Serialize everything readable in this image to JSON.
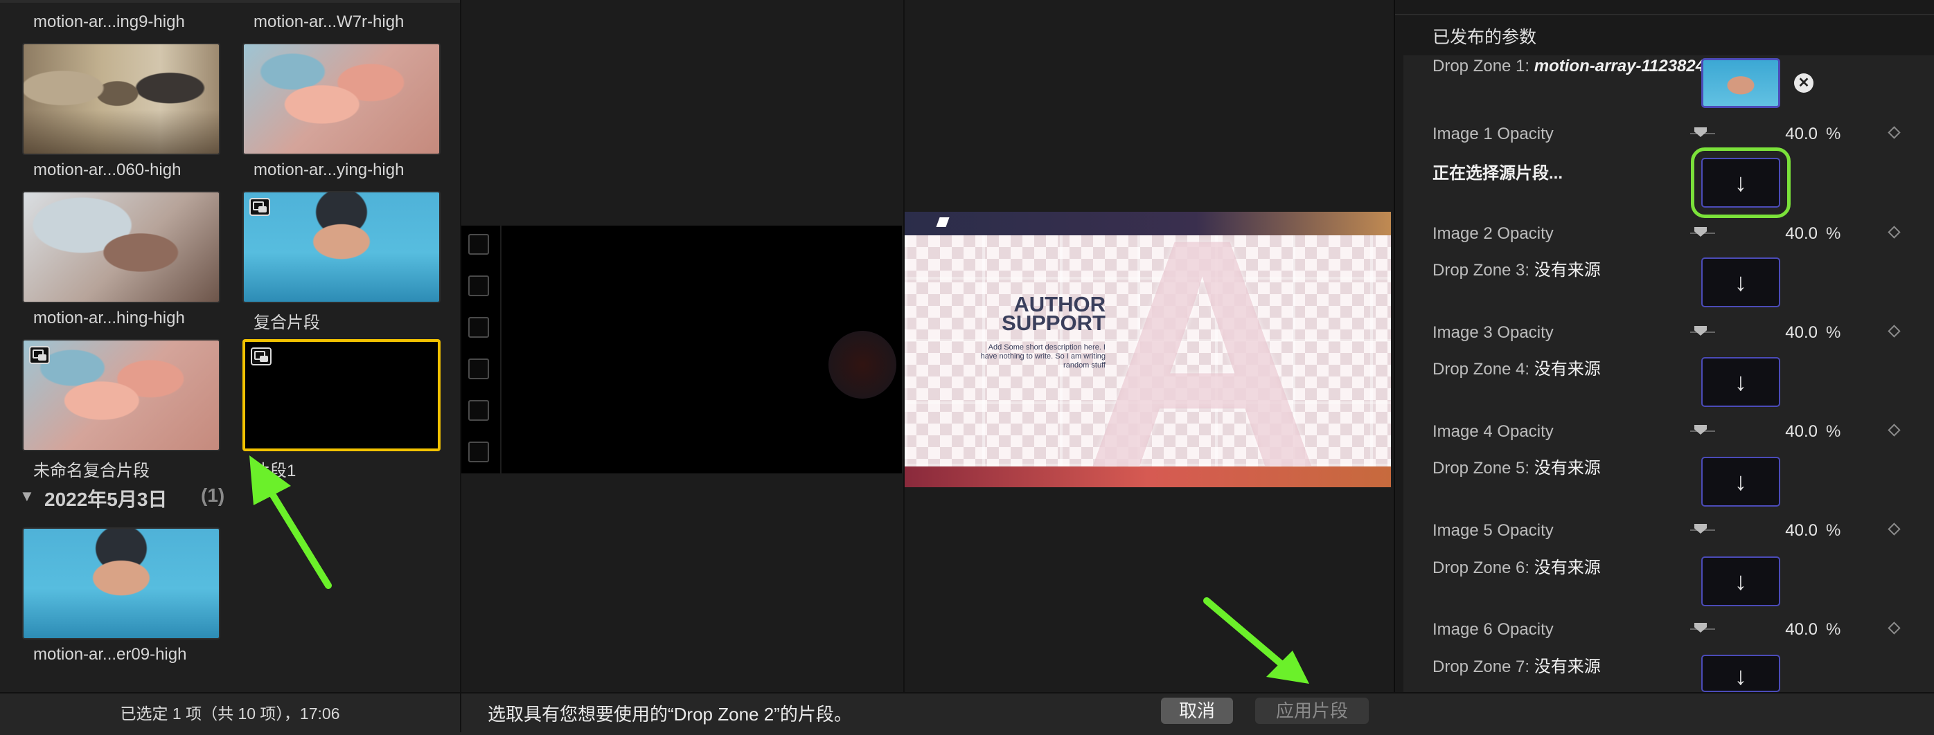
{
  "browser": {
    "clips": [
      {
        "label": "motion-ar...ing9-high"
      },
      {
        "label": "motion-ar...W7r-high"
      },
      {
        "label": "motion-ar...060-high"
      },
      {
        "label": "motion-ar...ying-high"
      },
      {
        "label": "motion-ar...hing-high"
      },
      {
        "label": "复合片段"
      },
      {
        "label": "未命名复合片段"
      },
      {
        "label": "片段1"
      },
      {
        "label": "motion-ar...er09-high"
      }
    ],
    "group": {
      "arrow": "▼",
      "date": "2022年5月3日",
      "count": "(1)"
    },
    "status": "已选定 1 项（共 10 项），17:06"
  },
  "template": {
    "title_line1": "AUTHOR",
    "title_line2": "SUPPORT",
    "description": "Add Some short description here. I have nothing to write. So I am writing random stuff",
    "big_letter": "A"
  },
  "inspector": {
    "section_title": "已发布的参数",
    "drop_zone_1": {
      "prefix": "Drop Zone 1: ",
      "value": "motion-array-1123824"
    },
    "selecting": "正在选择源片段...",
    "rows": [
      {
        "opacity_label": "Image 1 Opacity",
        "value": "40.0",
        "unit": "%"
      },
      {
        "opacity_label": "Image 2 Opacity",
        "value": "40.0",
        "unit": "%",
        "zone_prefix": "Drop Zone 3: ",
        "zone_value": "没有来源"
      },
      {
        "opacity_label": "Image 3 Opacity",
        "value": "40.0",
        "unit": "%",
        "zone_prefix": "Drop Zone 4: ",
        "zone_value": "没有来源"
      },
      {
        "opacity_label": "Image 4 Opacity",
        "value": "40.0",
        "unit": "%",
        "zone_prefix": "Drop Zone 5: ",
        "zone_value": "没有来源"
      },
      {
        "opacity_label": "Image 5 Opacity",
        "value": "40.0",
        "unit": "%",
        "zone_prefix": "Drop Zone 6: ",
        "zone_value": "没有来源"
      },
      {
        "opacity_label": "Image 6 Opacity",
        "value": "40.0",
        "unit": "%",
        "zone_prefix": "Drop Zone 7: ",
        "zone_value": "没有来源"
      }
    ],
    "well_icon": "↓",
    "remove_icon": "✕"
  },
  "footer": {
    "instruction": "选取具有您想要使用的“Drop Zone 2”的片段。",
    "cancel": "取消",
    "apply": "应用片段"
  },
  "colors": {
    "selection": "#f2c200",
    "highlight": "#7be23a",
    "well_border": "#4b4bb8"
  }
}
